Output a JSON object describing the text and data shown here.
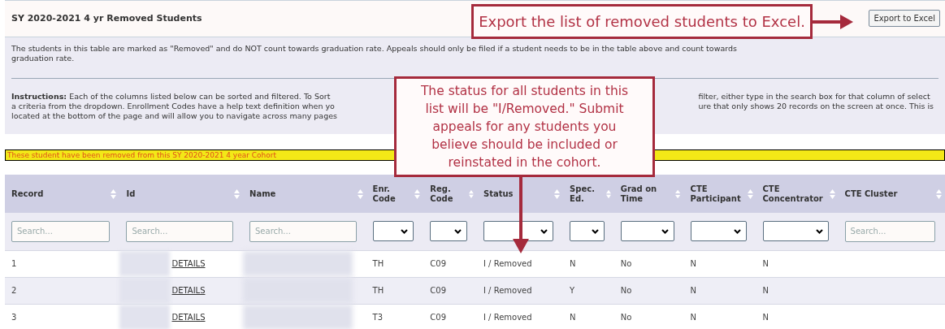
{
  "title": "SY 2020-2021 4 yr Removed Students",
  "export_button": "Export to Excel",
  "description": "The students in this table are marked as \"Removed\" and do NOT count towards graduation rate. Appeals should only be filed if a student needs to be in the table above and count towards graduation rate.",
  "instructions": {
    "left_lines": [
      "**Instructions:** Each of the columns listed below can be sorted and filtered. To Sort",
      "a criteria from the dropdown. Enrollment Codes have a help text definition when yo",
      "located at the bottom of the page and will allow you to navigate across many pages"
    ],
    "right_lines": [
      "filter, either type in the search box for that column of select",
      "ure that only shows 20 records on the screen at once. This is"
    ]
  },
  "banner": "These student have been removed from this SY 2020-2021 4 year Cohort",
  "table": {
    "columns": [
      {
        "label": "Record",
        "kind": "search",
        "placeholder": "Search..."
      },
      {
        "label": "Id",
        "kind": "search",
        "placeholder": "Search..."
      },
      {
        "label": "Name",
        "kind": "search",
        "placeholder": "Search..."
      },
      {
        "label": "Enr. Code",
        "kind": "select"
      },
      {
        "label": "Reg. Code",
        "kind": "select"
      },
      {
        "label": "Status",
        "kind": "select"
      },
      {
        "label": "Spec. Ed.",
        "kind": "select"
      },
      {
        "label": "Grad on Time",
        "kind": "select"
      },
      {
        "label": "CTE Participant",
        "kind": "select"
      },
      {
        "label": "CTE Concentrator",
        "kind": "select"
      },
      {
        "label": "CTE Cluster",
        "kind": "search",
        "placeholder": "Search..."
      }
    ],
    "rows": [
      {
        "record": "1",
        "id_link": "DETAILS",
        "enr_code": "TH",
        "reg_code": "C09",
        "status": "I / Removed",
        "spec_ed": "N",
        "grad_on_time": "No",
        "cte_participant": "N",
        "cte_concentrator": "N"
      },
      {
        "record": "2",
        "id_link": "DETAILS",
        "enr_code": "TH",
        "reg_code": "C09",
        "status": "I / Removed",
        "spec_ed": "Y",
        "grad_on_time": "No",
        "cte_participant": "N",
        "cte_concentrator": "N"
      },
      {
        "record": "3",
        "id_link": "DETAILS",
        "enr_code": "T3",
        "reg_code": "C09",
        "status": "I / Removed",
        "spec_ed": "N",
        "grad_on_time": "No",
        "cte_participant": "N",
        "cte_concentrator": "N"
      }
    ]
  },
  "callouts": [
    {
      "text": "Export the list of removed students to Excel.",
      "kind": "arrow_right"
    },
    {
      "text": "The status for all students in this list will be \"I/Removed.\" Submit appeals for any students you believe should be included or reinstated in the cohort.",
      "kind": "arrow_down"
    }
  ]
}
